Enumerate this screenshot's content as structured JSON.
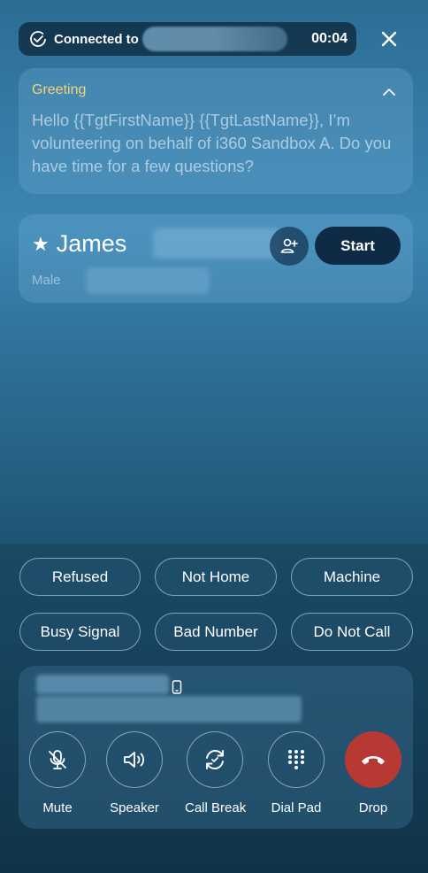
{
  "status": {
    "connected_label": "Connected to",
    "timer": "00:04"
  },
  "greeting": {
    "title": "Greeting",
    "text": "Hello {{TgtFirstName}} {{TgtLastName}}, I’m volunteering on behalf of i360 Sandbox A. Do you have time for a few questions?"
  },
  "contact": {
    "star": "★",
    "first_name": "James",
    "gender": "Male",
    "start_label": "Start"
  },
  "dispositions": [
    "Refused",
    "Not Home",
    "Machine",
    "Busy Signal",
    "Bad Number",
    "Do Not Call"
  ],
  "controls": {
    "mute": "Mute",
    "speaker": "Speaker",
    "call_break": "Call Break",
    "dial_pad": "Dial Pad",
    "drop": "Drop"
  },
  "colors": {
    "greeting_title": "#f3d673",
    "start_button": "#0f2a45",
    "drop_button": "#b63a33"
  },
  "icons": [
    "check-circle-icon",
    "close-icon",
    "chevron-up-icon",
    "star-icon",
    "add-person-icon",
    "phone-icon",
    "mic-off-icon",
    "speaker-icon",
    "refresh-icon",
    "keypad-icon",
    "hang-up-icon"
  ]
}
